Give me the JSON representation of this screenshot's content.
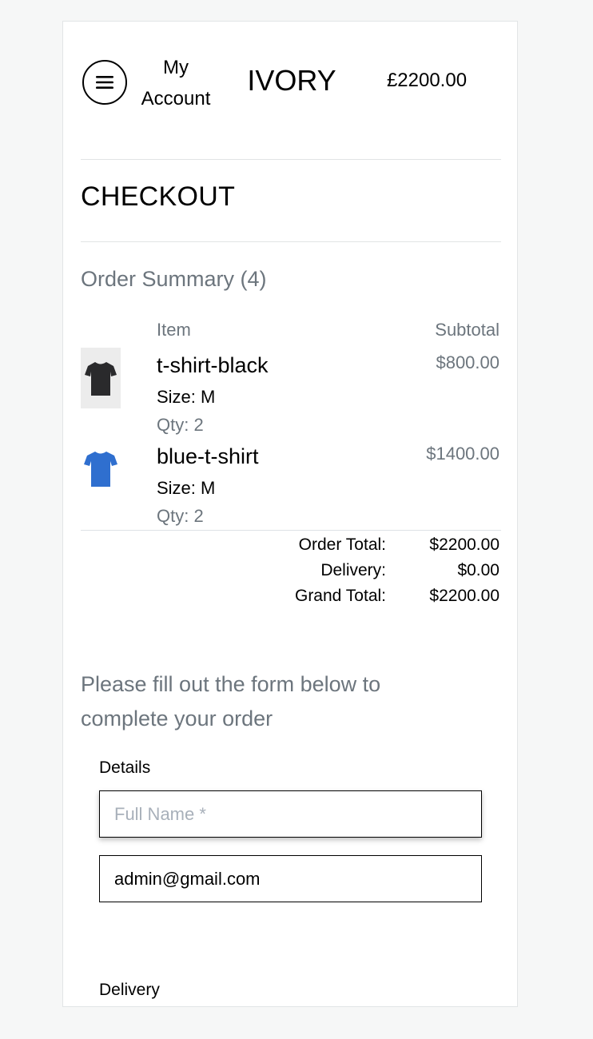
{
  "header": {
    "account_link": "My Account",
    "brand": "IVORY",
    "cart_total": "£2200.00",
    "menu_icon": "menu-icon"
  },
  "checkout": {
    "title": "CHECKOUT"
  },
  "order_summary": {
    "title": "Order Summary (4)",
    "columns": {
      "item": "Item",
      "subtotal": "Subtotal"
    },
    "items": [
      {
        "name": "t-shirt-black",
        "size": "Size: M",
        "qty": "Qty: 2",
        "subtotal": "$800.00",
        "shirt_color": "#2a2a2c",
        "thumb_bg": "#ececec"
      },
      {
        "name": "blue-t-shirt",
        "size": "Size: M",
        "qty": "Qty: 2",
        "subtotal": "$1400.00",
        "shirt_color": "#2f6fcf",
        "thumb_bg": "#ffffff"
      }
    ],
    "totals": {
      "order_total_label": "Order Total:",
      "order_total": "$2200.00",
      "delivery_label": "Delivery:",
      "delivery": "$0.00",
      "grand_total_label": "Grand Total:",
      "grand_total": "$2200.00"
    }
  },
  "form": {
    "intro": "Please fill out the form below to complete your order",
    "details_label": "Details",
    "full_name": {
      "placeholder": "Full Name *",
      "value": ""
    },
    "email": {
      "placeholder": "",
      "value": "admin@gmail.com"
    },
    "delivery_label": "Delivery"
  }
}
